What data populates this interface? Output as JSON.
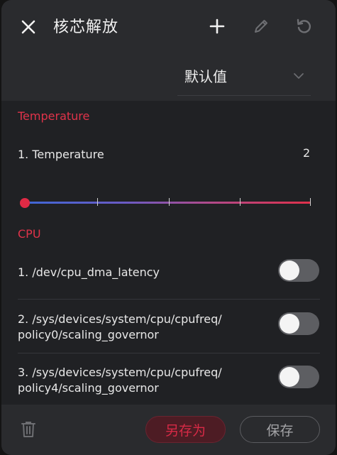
{
  "header": {
    "title": "核芯解放",
    "profile_selected": "默认值"
  },
  "sections": {
    "temperature": {
      "title": "Temperature",
      "item_label": "1. Temperature",
      "item_value": "2",
      "slider_fraction": 0.0
    },
    "cpu": {
      "title": "CPU",
      "items": [
        {
          "label": "1. /dev/cpu_dma_latency",
          "enabled": false
        },
        {
          "label_line1": "2. /sys/devices/system/cpu/cpufreq/",
          "label_line2": "policy0/scaling_governor",
          "enabled": false
        },
        {
          "label_line1": "3. /sys/devices/system/cpu/cpufreq/",
          "label_line2": "policy4/scaling_governor",
          "enabled": false
        }
      ]
    }
  },
  "footer": {
    "save_as_label": "另存为",
    "save_label": "保存"
  },
  "colors": {
    "accent": "#e0334a",
    "background": "#202124",
    "header": "#2a2b2e",
    "slider_start": "#3f67d6",
    "slider_end": "#e0304a"
  },
  "icons": [
    "close-icon",
    "plus-icon",
    "pencil-icon",
    "reset-icon",
    "chevron-down-icon",
    "trash-icon"
  ]
}
